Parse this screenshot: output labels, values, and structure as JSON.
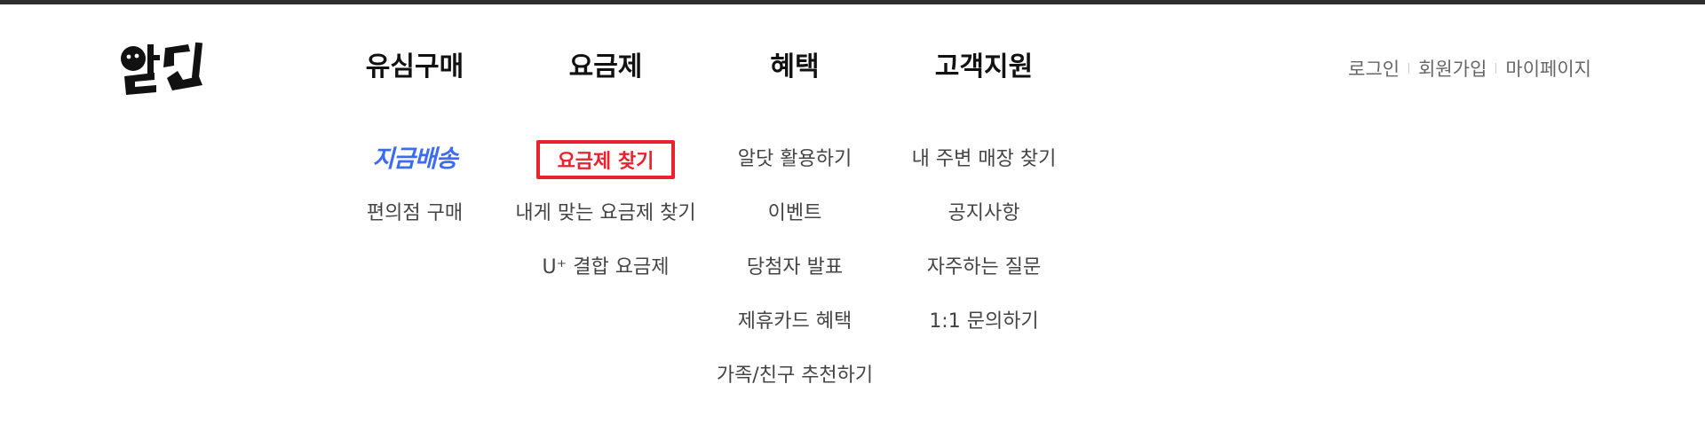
{
  "logo": {
    "text": "알닷",
    "icon": "aldot-logo-icon"
  },
  "main_nav": [
    {
      "label": "유심구매"
    },
    {
      "label": "요금제"
    },
    {
      "label": "혜택"
    },
    {
      "label": "고객지원"
    }
  ],
  "util_nav": [
    {
      "label": "로그인"
    },
    {
      "label": "회원가입"
    },
    {
      "label": "마이페이지"
    }
  ],
  "submenu": {
    "sim": [
      {
        "label": "지금배송"
      },
      {
        "label": "편의점 구매"
      }
    ],
    "plans": [
      {
        "label": "요금제 찾기"
      },
      {
        "label": "내게 맞는 요금제 찾기"
      },
      {
        "label": "U⁺ 결합 요금제"
      }
    ],
    "benefits": [
      {
        "label": "알닷 활용하기"
      },
      {
        "label": "이벤트"
      },
      {
        "label": "당첨자 발표"
      },
      {
        "label": "제휴카드 혜택"
      },
      {
        "label": "가족/친구 추천하기"
      }
    ],
    "support": [
      {
        "label": "내 주변 매장 찾기"
      },
      {
        "label": "공지사항"
      },
      {
        "label": "자주하는 질문"
      },
      {
        "label": "1:1 문의하기"
      }
    ]
  },
  "colors": {
    "active": "#e8232d",
    "brand_blue": "#3d6cf2",
    "top_bar": "#2e2e2e"
  }
}
